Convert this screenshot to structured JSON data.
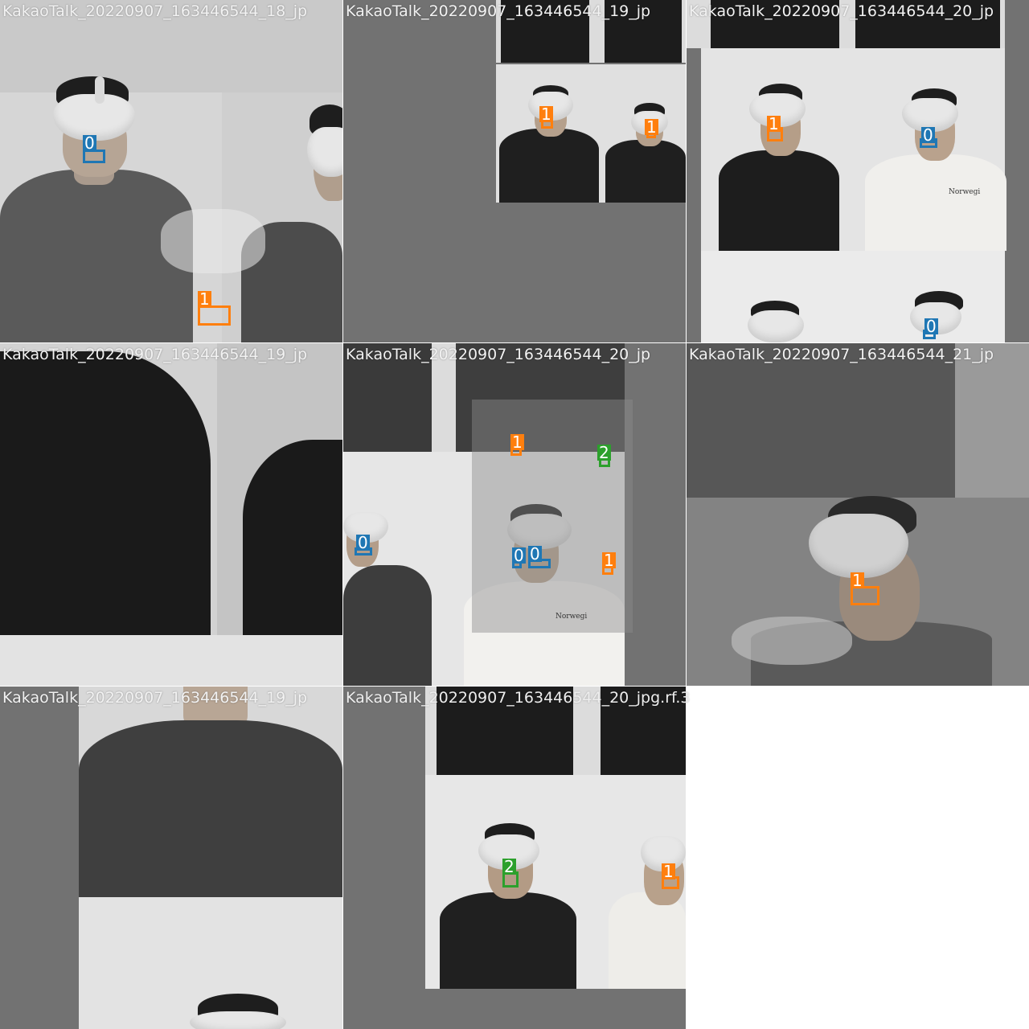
{
  "tiles": [
    {
      "title": "KakaoTalk_20220907_163446544_18_jp"
    },
    {
      "title": "KakaoTalk_20220907_163446544_19_jp"
    },
    {
      "title": "KakaoTalk_20220907_163446544_20_jp"
    },
    {
      "title": "KakaoTalk_20220907_163446544_19_jp"
    },
    {
      "title": "KakaoTalk_20220907_163446544_20_jp"
    },
    {
      "title": "KakaoTalk_20220907_163446544_21_jp"
    },
    {
      "title": "KakaoTalk_20220907_163446544_19_jp"
    },
    {
      "title": "KakaoTalk_20220907_163446544_20_jpg.rf.3"
    }
  ],
  "class_colors": {
    "0": "#1f77b4",
    "1": "#ff7f0e",
    "2": "#2ca02c"
  },
  "boxes": {
    "t0": [
      "0",
      "1"
    ],
    "t1": [
      "1",
      "1"
    ],
    "t2": [
      "1",
      "0",
      "0"
    ],
    "t4": [
      "1",
      "2",
      "0",
      "0",
      "0",
      "1"
    ],
    "t5": [
      "1"
    ],
    "t7": [
      "2",
      "1"
    ]
  },
  "shirt_text": "Norwegi"
}
